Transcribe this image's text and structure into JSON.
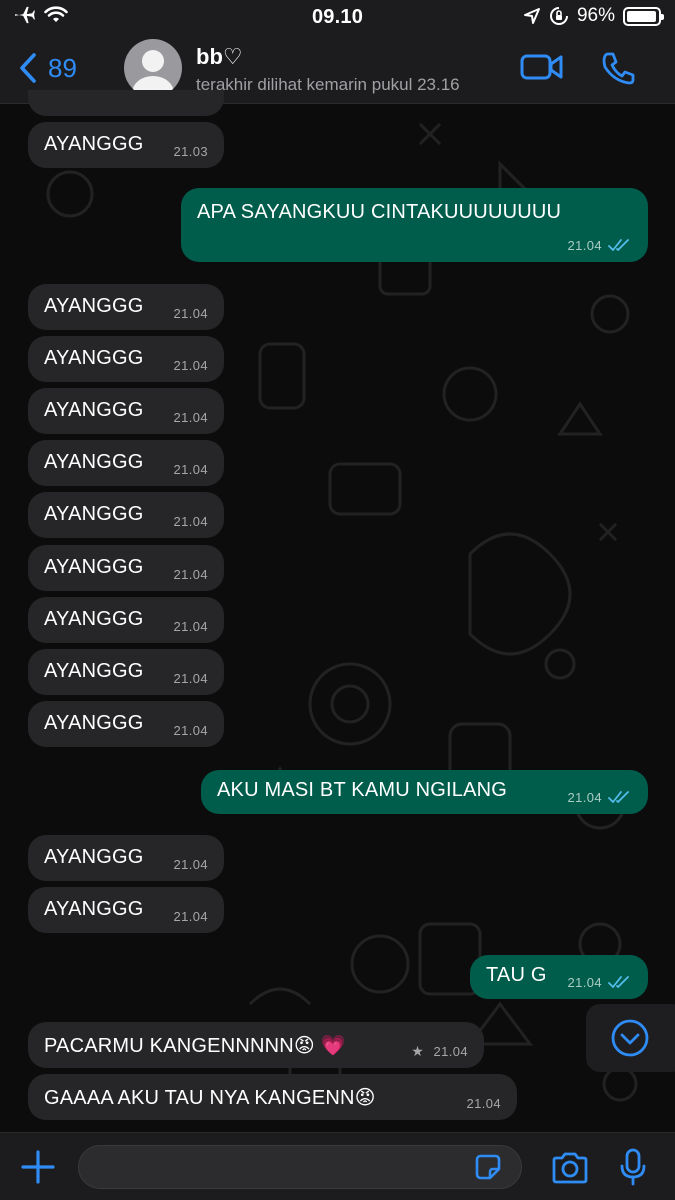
{
  "status_bar": {
    "time": "09.10",
    "battery": "96%",
    "battery_level": 0.96
  },
  "header": {
    "back_count": "89",
    "contact_name": "bb♡",
    "last_seen": "terakhir dilihat kemarin pukul 23.16"
  },
  "messages": [
    {
      "dir": "in",
      "text": "AYANGGG",
      "time": "21.03"
    },
    {
      "dir": "out",
      "text": "APA SAYANGKUU CINTAKUUUUUUUU",
      "time": "21.04",
      "read": true
    },
    {
      "dir": "in",
      "text": "AYANGGG",
      "time": "21.04"
    },
    {
      "dir": "in",
      "text": "AYANGGG",
      "time": "21.04"
    },
    {
      "dir": "in",
      "text": "AYANGGG",
      "time": "21.04"
    },
    {
      "dir": "in",
      "text": "AYANGGG",
      "time": "21.04"
    },
    {
      "dir": "in",
      "text": "AYANGGG",
      "time": "21.04"
    },
    {
      "dir": "in",
      "text": "AYANGGG",
      "time": "21.04"
    },
    {
      "dir": "in",
      "text": "AYANGGG",
      "time": "21.04"
    },
    {
      "dir": "in",
      "text": "AYANGGG",
      "time": "21.04"
    },
    {
      "dir": "in",
      "text": "AYANGGG",
      "time": "21.04"
    },
    {
      "dir": "out",
      "text": "AKU MASI BT KAMU NGILANG",
      "time": "21.04",
      "read": true
    },
    {
      "dir": "in",
      "text": "AYANGGG",
      "time": "21.04"
    },
    {
      "dir": "in",
      "text": "AYANGGG",
      "time": "21.04"
    },
    {
      "dir": "out",
      "text": "TAU G",
      "time": "21.04",
      "read": true
    },
    {
      "dir": "in",
      "text": "PACARMU KANGENNNNN😡 💗",
      "time": "21.04",
      "starred": true
    },
    {
      "dir": "in",
      "text": "GAAAA AKU TAU NYA KANGENN😡",
      "time": "21.04"
    }
  ],
  "colors": {
    "accent": "#2f8cf5",
    "incoming_bubble": "#262628",
    "outgoing_bubble": "#005c4b",
    "read_ticks": "#53bdeb",
    "bar_background": "#1c1c1e"
  },
  "icons": {
    "status_left": [
      "airplane-icon",
      "wifi-icon"
    ],
    "status_right": [
      "location-icon",
      "rotation-lock-icon",
      "battery-icon"
    ],
    "header": [
      "chevron-left-icon",
      "video-call-icon",
      "phone-icon"
    ],
    "composer": [
      "plus-icon",
      "sticker-icon",
      "camera-icon",
      "microphone-icon"
    ],
    "scroll": "chevron-down-circle-icon"
  }
}
